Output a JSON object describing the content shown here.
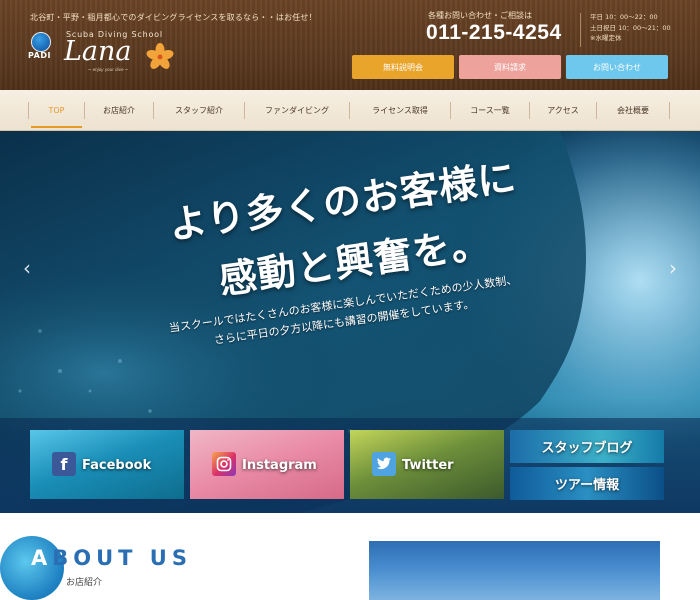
{
  "header": {
    "tagline": "北谷町・平野・稲月都心でのダイビングライセンスを取るなら・・はお任せ！",
    "logo": {
      "org": "PADI",
      "subtitle": "Scuba Diving School",
      "name": "Lana",
      "motto": "~ enjoy your dive ~"
    },
    "phone_label": "各種お問い合わせ・ご相談は",
    "phone": "011-215-4254",
    "hours": [
      "平日 10：00〜22：00",
      "土日祝日 10：00〜21：00",
      "※水曜定休"
    ],
    "buttons": {
      "briefing": "無料説明会",
      "documents": "資料請求",
      "contact": "お問い合わせ"
    }
  },
  "nav": {
    "items": [
      "TOP",
      "お店紹介",
      "スタッフ紹介",
      "ファンダイビング",
      "ライセンス取得",
      "コース一覧",
      "アクセス",
      "会社概要"
    ],
    "active": "TOP"
  },
  "hero": {
    "heading_line1": "より多くのお客様に",
    "heading_line2": "感動と興奮を。",
    "sub_line1": "当スクールではたくさんのお客様に楽しんでいただくための少人数制、",
    "sub_line2": "さらに平日の夕方以降にも講習の開催をしています。",
    "prev": "‹",
    "next": "›"
  },
  "social": {
    "facebook": "Facebook",
    "instagram": "Instagram",
    "twitter": "Twitter",
    "staff_blog": "スタッフブログ",
    "tour_info": "ツアー情報"
  },
  "about": {
    "title_white": "A",
    "title_rest": "BOUT US",
    "subtitle": "お店紹介"
  },
  "colors": {
    "header_wood": "#5b3a20",
    "btn_briefing": "#e9a42b",
    "btn_documents": "#eea29c",
    "btn_contact": "#6ec7ec",
    "nav_active": "#e59a2a"
  }
}
